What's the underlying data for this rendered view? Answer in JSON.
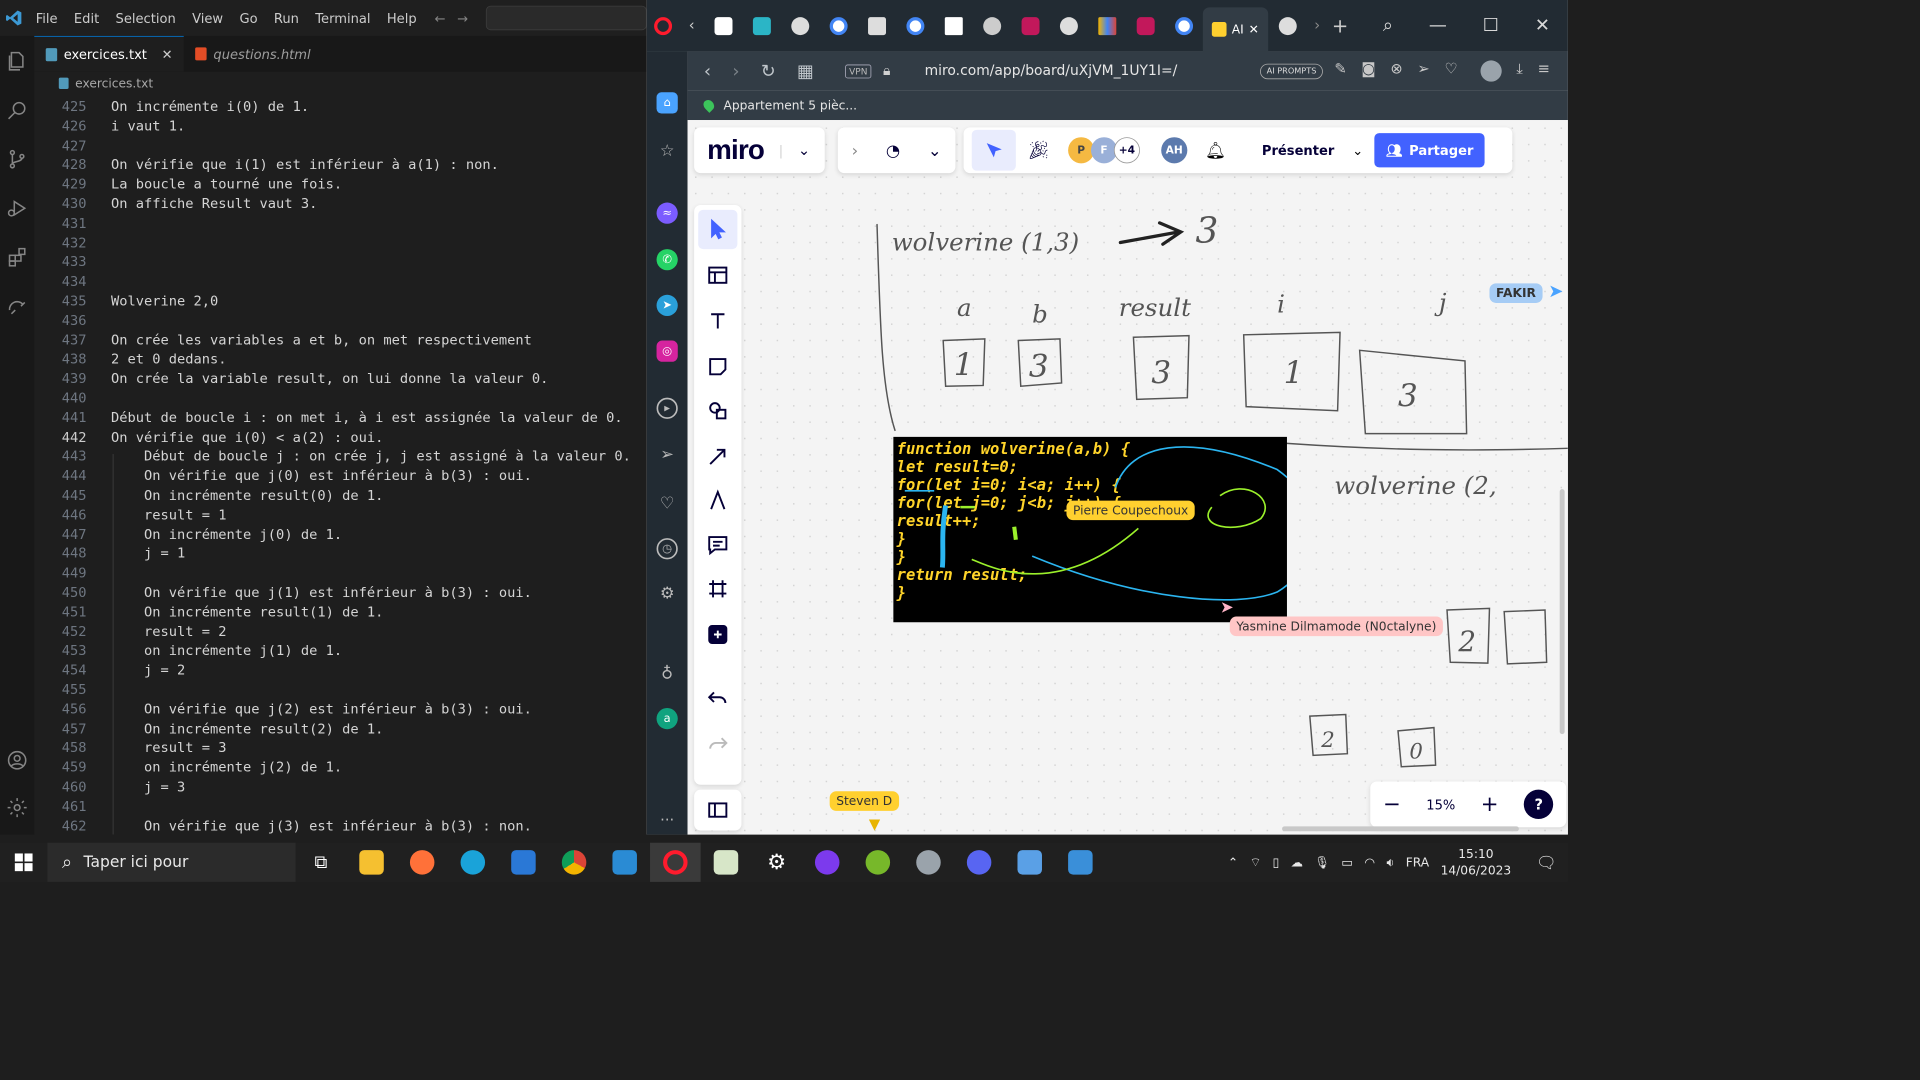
{
  "vscode": {
    "menu": [
      "File",
      "Edit",
      "Selection",
      "View",
      "Go",
      "Run",
      "Terminal",
      "Help"
    ],
    "tabs": [
      {
        "label": "exercices.txt",
        "active": true
      },
      {
        "label": "questions.html",
        "active": false
      }
    ],
    "breadcrumb": "exercices.txt",
    "lines": [
      {
        "n": "425",
        "text": "On incrémente i(0) de 1."
      },
      {
        "n": "426",
        "text": "i vaut 1."
      },
      {
        "n": "427",
        "text": ""
      },
      {
        "n": "428",
        "text": "On vérifie que i(1) est inférieur à a(1) : non."
      },
      {
        "n": "429",
        "text": "La boucle a tourné une fois."
      },
      {
        "n": "430",
        "text": "On affiche Result vaut 3."
      },
      {
        "n": "431",
        "text": ""
      },
      {
        "n": "432",
        "text": ""
      },
      {
        "n": "433",
        "text": ""
      },
      {
        "n": "434",
        "text": ""
      },
      {
        "n": "435",
        "text": "Wolverine 2,0"
      },
      {
        "n": "436",
        "text": ""
      },
      {
        "n": "437",
        "text": "On crée les variables a et b, on met respectivement"
      },
      {
        "n": "438",
        "text": "2 et 0 dedans."
      },
      {
        "n": "439",
        "text": "On crée la variable result, on lui donne la valeur 0."
      },
      {
        "n": "440",
        "text": ""
      },
      {
        "n": "441",
        "text": "Début de boucle i : on met i, à i est assignée la valeur de 0."
      },
      {
        "n": "442",
        "text": "On vérifie que i(0) < a(2) : oui."
      },
      {
        "n": "443",
        "text": "    Début de boucle j : on crée j, j est assigné à la valeur 0."
      },
      {
        "n": "444",
        "text": "    On vérifie que j(0) est inférieur à b(3) : oui."
      },
      {
        "n": "445",
        "text": "    On incrémente result(0) de 1."
      },
      {
        "n": "446",
        "text": "    result = 1"
      },
      {
        "n": "447",
        "text": "    On incrémente j(0) de 1."
      },
      {
        "n": "448",
        "text": "    j = 1"
      },
      {
        "n": "449",
        "text": ""
      },
      {
        "n": "450",
        "text": "    On vérifie que j(1) est inférieur à b(3) : oui."
      },
      {
        "n": "451",
        "text": "    On incrémente result(1) de 1."
      },
      {
        "n": "452",
        "text": "    result = 2"
      },
      {
        "n": "453",
        "text": "    on incrémente j(1) de 1."
      },
      {
        "n": "454",
        "text": "    j = 2"
      },
      {
        "n": "455",
        "text": ""
      },
      {
        "n": "456",
        "text": "    On vérifie que j(2) est inférieur à b(3) : oui."
      },
      {
        "n": "457",
        "text": "    On incrémente result(2) de 1."
      },
      {
        "n": "458",
        "text": "    result = 3"
      },
      {
        "n": "459",
        "text": "    on incrémente j(2) de 1."
      },
      {
        "n": "460",
        "text": "    j = 3"
      },
      {
        "n": "461",
        "text": ""
      },
      {
        "n": "462",
        "text": "    On vérifie que j(3) est inférieur à b(3) : non."
      }
    ],
    "current_line": "442"
  },
  "browser": {
    "active_tab_label": "AI",
    "url": "miro.com/app/board/uXjVM_1UY1I=/",
    "vpn": "VPN",
    "ai_prompts": "AI PROMPTS",
    "bookmark": "Appartement 5 pièc..."
  },
  "miro": {
    "logo": "miro",
    "present": "Présenter",
    "share": "Partager",
    "avatars": [
      "P",
      "F",
      "+4",
      "AH"
    ],
    "zoom": "15%",
    "cursors": [
      {
        "name": "Pierre Coupechoux",
        "color": "#ffd02f"
      },
      {
        "name": "Yasmine Dilmamode (N0ctalyne)",
        "color": "#ffc6c6"
      },
      {
        "name": "Steven D",
        "color": "#ffd02f"
      },
      {
        "name": "FAKIR",
        "color": "#a6ccf5"
      }
    ],
    "handwriting": {
      "title": "wolverine (1,3)",
      "result": "3",
      "labels": [
        "a",
        "b",
        "result",
        "i",
        "j"
      ],
      "boxes": [
        "1",
        "3",
        "3",
        "1",
        "3"
      ],
      "title2": "wolverine (2,",
      "boxes2": [
        "2",
        "2",
        "0"
      ]
    },
    "code": [
      "function wolverine(a,b) {",
      "  let result=0;",
      "  for(let i=0; i<a; i++) {",
      "    for(let j=0; j<b; j++) {",
      "      result++;",
      "    }",
      "  }",
      "  return result;",
      "}"
    ]
  },
  "taskbar": {
    "search_placeholder": "Taper ici pour",
    "lang": "FRA",
    "time": "15:10",
    "date": "14/06/2023"
  }
}
